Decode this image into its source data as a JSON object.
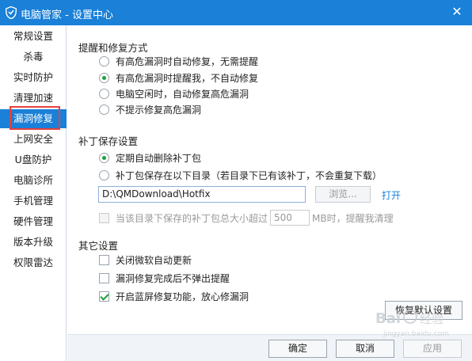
{
  "window": {
    "title": "电脑管家 - 设置中心",
    "close_glyph": "✕"
  },
  "sidebar": {
    "items": [
      {
        "label": "常规设置"
      },
      {
        "label": "杀毒"
      },
      {
        "label": "实时防护"
      },
      {
        "label": "清理加速"
      },
      {
        "label": "漏洞修复",
        "active": true
      },
      {
        "label": "上网安全"
      },
      {
        "label": "U盘防护"
      },
      {
        "label": "电脑诊所"
      },
      {
        "label": "手机管理"
      },
      {
        "label": "硬件管理"
      },
      {
        "label": "版本升级"
      },
      {
        "label": "权限雷达"
      }
    ],
    "active_color": "#1a80d8",
    "highlight_color": "#e8403a"
  },
  "main": {
    "repair_mode": {
      "title": "提醒和修复方式",
      "options": [
        {
          "label": "有高危漏洞时自动修复，无需提醒",
          "checked": false
        },
        {
          "label": "有高危漏洞时提醒我，不自动修复",
          "checked": true
        },
        {
          "label": "电脑空闲时，自动修复高危漏洞",
          "checked": false
        },
        {
          "label": "不提示修复高危漏洞",
          "checked": false
        }
      ]
    },
    "patch_storage": {
      "title": "补丁保存设置",
      "options": [
        {
          "label": "定期自动删除补丁包",
          "checked": true
        },
        {
          "label": "补丁包保存在以下目录（若目录下已有该补丁，不会重复下载）",
          "checked": false
        }
      ],
      "path_value": "D:\\QMDownload\\Hotfix",
      "browse_label": "浏览...",
      "open_label": "打开",
      "size_limit_label": "当该目录下保存的补丁包总大小超过",
      "size_limit_value": "500",
      "size_limit_suffix": "MB时，提醒我清理",
      "size_limit_checked": false
    },
    "other": {
      "title": "其它设置",
      "options": [
        {
          "label": "关闭微软自动更新",
          "checked": false
        },
        {
          "label": "漏洞修复完成后不弹出提醒",
          "checked": false
        },
        {
          "label": "开启蓝屏修复功能，放心修漏洞",
          "checked": true
        }
      ]
    },
    "restore_label": "恢复默认设置"
  },
  "footer": {
    "ok_label": "确定",
    "cancel_label": "取消",
    "apply_label": "应用"
  },
  "watermark": {
    "text": "Bai 经验",
    "subtext": "jingyan.baidu.com"
  },
  "colors": {
    "titlebar": "#1a80d8",
    "check": "#1e9e3a",
    "link": "#1a80d8"
  }
}
